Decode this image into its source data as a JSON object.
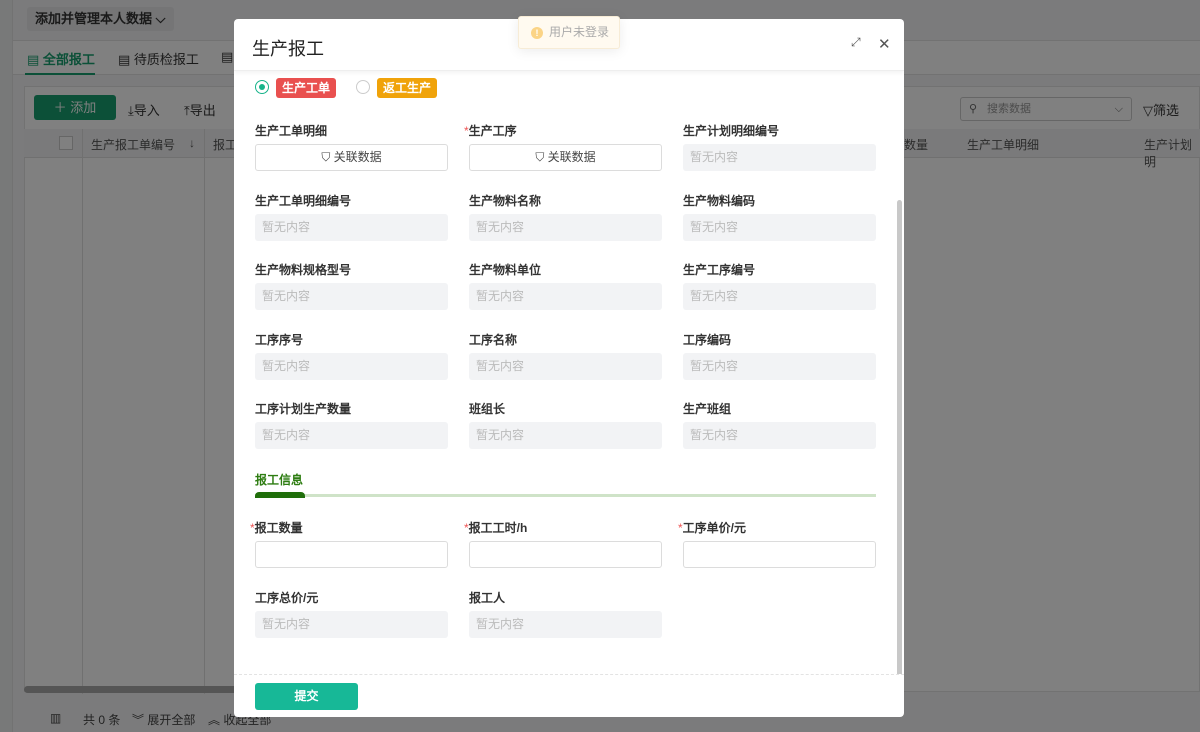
{
  "background": {
    "view_selector": "添加并管理本人数据",
    "tabs": [
      {
        "label": "全部报工"
      },
      {
        "label": "待质检报工"
      }
    ],
    "toolbar": {
      "add": "添加",
      "import": "导入",
      "export": "导出",
      "search_placeholder": "搜索数据",
      "filter": "筛选"
    },
    "columns": [
      "生产报工单编号",
      "报工",
      "数量",
      "生产工单明细",
      "生产计划明"
    ],
    "footer": {
      "total": "共 0 条",
      "expand": "展开全部",
      "collapse": "收起全部"
    }
  },
  "toast": {
    "text": "用户未登录"
  },
  "modal": {
    "title": "生产报工",
    "radio_options": [
      {
        "label": "生产工单",
        "color": "#e9504f",
        "selected": true
      },
      {
        "label": "返工生产",
        "color": "#f0a30a",
        "selected": false
      }
    ],
    "empty": "暂无内容",
    "link_label": "关联数据",
    "fields": [
      {
        "label": "生产工单明细",
        "type": "link",
        "required": false
      },
      {
        "label": "生产工序",
        "type": "link",
        "required": true
      },
      {
        "label": "生产计划明细编号",
        "type": "ro"
      },
      {
        "label": "生产工单明细编号",
        "type": "ro"
      },
      {
        "label": "生产物料名称",
        "type": "ro"
      },
      {
        "label": "生产物料编码",
        "type": "ro"
      },
      {
        "label": "生产物料规格型号",
        "type": "ro"
      },
      {
        "label": "生产物料单位",
        "type": "ro"
      },
      {
        "label": "生产工序编号",
        "type": "ro"
      },
      {
        "label": "工序序号",
        "type": "ro"
      },
      {
        "label": "工序名称",
        "type": "ro"
      },
      {
        "label": "工序编码",
        "type": "ro"
      },
      {
        "label": "工序计划生产数量",
        "type": "ro"
      },
      {
        "label": "班组长",
        "type": "ro"
      },
      {
        "label": "生产班组",
        "type": "ro"
      }
    ],
    "section_title": "报工信息",
    "section_fields": [
      {
        "label": "报工数量",
        "type": "input",
        "required": true,
        "value": ""
      },
      {
        "label": "报工工时/h",
        "type": "input",
        "required": true,
        "value": ""
      },
      {
        "label": "工序单价/元",
        "type": "input",
        "required": true,
        "value": ""
      },
      {
        "label": "工序总价/元",
        "type": "ro"
      },
      {
        "label": "报工人",
        "type": "ro"
      }
    ],
    "submit": "提交"
  }
}
